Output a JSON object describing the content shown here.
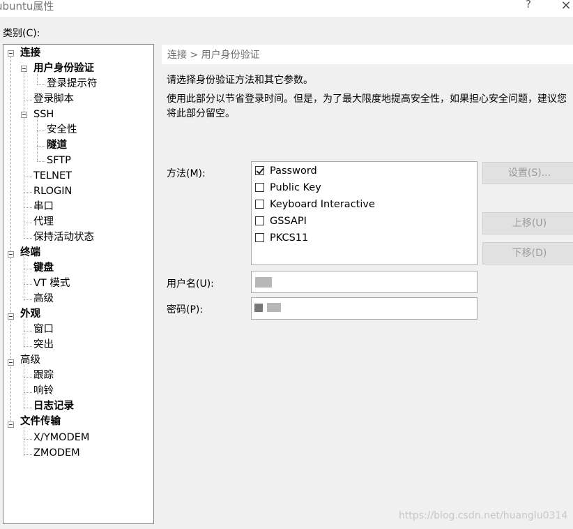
{
  "window": {
    "title": "ubuntu属性",
    "help": "?",
    "close": "×"
  },
  "category_label": "类别(C):",
  "tree": {
    "items": [
      {
        "label": "连接",
        "bold": true
      },
      {
        "label": "用户身份验证",
        "bold": true
      },
      {
        "label": "登录提示符",
        "bold": false
      },
      {
        "label": "登录脚本",
        "bold": false
      },
      {
        "label": "SSH",
        "bold": false
      },
      {
        "label": "安全性",
        "bold": false
      },
      {
        "label": "隧道",
        "bold": true
      },
      {
        "label": "SFTP",
        "bold": false
      },
      {
        "label": "TELNET",
        "bold": false
      },
      {
        "label": "RLOGIN",
        "bold": false
      },
      {
        "label": "串口",
        "bold": false
      },
      {
        "label": "代理",
        "bold": false
      },
      {
        "label": "保持活动状态",
        "bold": false
      },
      {
        "label": "终端",
        "bold": true
      },
      {
        "label": "键盘",
        "bold": true
      },
      {
        "label": "VT 模式",
        "bold": false
      },
      {
        "label": "高级",
        "bold": false
      },
      {
        "label": "外观",
        "bold": true
      },
      {
        "label": "窗口",
        "bold": false
      },
      {
        "label": "突出",
        "bold": false
      },
      {
        "label": "高级",
        "bold": false
      },
      {
        "label": "跟踪",
        "bold": false
      },
      {
        "label": "响铃",
        "bold": false
      },
      {
        "label": "日志记录",
        "bold": true
      },
      {
        "label": "文件传输",
        "bold": true
      },
      {
        "label": "X/YMODEM",
        "bold": false
      },
      {
        "label": "ZMODEM",
        "bold": false
      }
    ]
  },
  "panel": {
    "breadcrumb": "连接 > 用户身份验证",
    "description1": "请选择身份验证方法和其它参数。",
    "description2": "使用此部分以节省登录时间。但是，为了最大限度地提高安全性，如果担心安全问题，建议您将此部分留空。",
    "method_label": "方法(M):",
    "methods": [
      {
        "label": "Password",
        "checked": true
      },
      {
        "label": "Public Key",
        "checked": false
      },
      {
        "label": "Keyboard Interactive",
        "checked": false
      },
      {
        "label": "GSSAPI",
        "checked": false
      },
      {
        "label": "PKCS11",
        "checked": false
      }
    ],
    "buttons": {
      "settings": "设置(S)...",
      "move_up": "上移(U)",
      "move_down": "下移(D)"
    },
    "username_label": "用户名(U):",
    "password_label": "密码(P):"
  },
  "watermark": "https://blog.csdn.net/huanglu0314"
}
